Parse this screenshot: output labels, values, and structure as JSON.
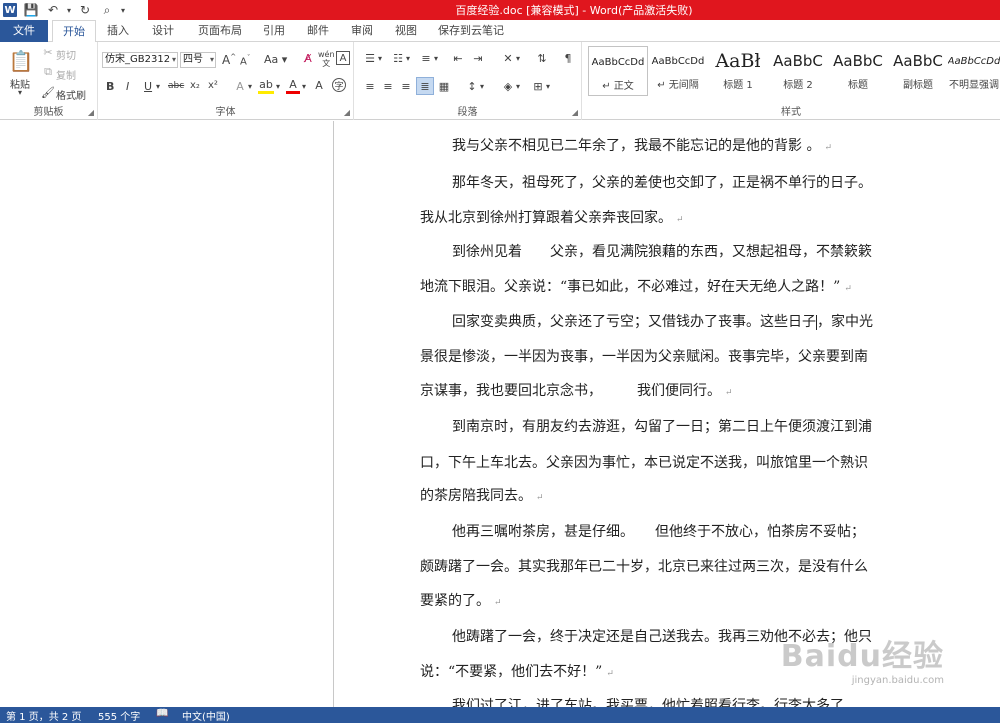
{
  "window": {
    "title": "百度经验.doc [兼容模式] - Word(产品激活失败)"
  },
  "tabs": [
    {
      "label": "文件"
    },
    {
      "label": "开始"
    },
    {
      "label": "插入"
    },
    {
      "label": "设计"
    },
    {
      "label": "页面布局"
    },
    {
      "label": "引用"
    },
    {
      "label": "邮件"
    },
    {
      "label": "审阅"
    },
    {
      "label": "视图"
    },
    {
      "label": "保存到云笔记"
    }
  ],
  "clipboard": {
    "paste": "粘贴",
    "cut": "剪切",
    "copy": "复制",
    "format_painter": "格式刷",
    "group_label": "剪贴板"
  },
  "font": {
    "name": "仿宋_GB2312",
    "size": "四号",
    "grow": "A",
    "shrink": "A",
    "case": "Aa",
    "bold": "B",
    "italic": "I",
    "underline": "U",
    "strike": "abc",
    "subscript": "x₂",
    "superscript": "x²",
    "phonetic": "wén",
    "group_label": "字体"
  },
  "paragraph": {
    "group_label": "段落"
  },
  "styles": {
    "group_label": "样式",
    "items": [
      {
        "preview": "AaBbCcDd",
        "name": "↵ 正文"
      },
      {
        "preview": "AaBbCcDd",
        "name": "↵ 无间隔"
      },
      {
        "preview": "AaBł",
        "name": "标题 1"
      },
      {
        "preview": "AaBbC",
        "name": "标题 2"
      },
      {
        "preview": "AaBbC",
        "name": "标题"
      },
      {
        "preview": "AaBbC",
        "name": "副标题"
      },
      {
        "preview": "AaBbCcDd",
        "name": "不明显强调"
      }
    ]
  },
  "document": {
    "lines": [
      "我与父亲不相见已二年余了，我最不能忘记的是他的背影 。",
      "那年冬天，祖母死了，父亲的差使也交卸了，正是祸不单行的日子。",
      "我从北京到徐州打算跟着父亲奔丧回家。",
      "到徐州见着　　父亲，看见满院狼藉的东西，又想起祖母，不禁簌簌",
      "地流下眼泪。父亲说：“事已如此，不必难过，好在天无绝人之路！”",
      "回家变卖典质，父亲还了亏空；又借钱办了丧事。这些日子",
      "，家中光",
      "景很是惨淡，一半因为丧事，一半因为父亲赋闲。丧事完毕，父亲要到南",
      "京谋事，我也要回北京念书，　　　我们便同行。",
      "到南京时，有朋友约去游逛，勾留了一日；第二日上午便须渡江到浦",
      "口，下午上车北去。父亲因为事忙，本已说定不送我，叫旅馆里一个熟识",
      "的茶房陪我同去。",
      "他再三嘱咐茶房，甚是仔细。　　但他终于不放心，怕茶房不妥帖；",
      "颇踌躇了一会。其实我那年已二十岁，北京已来往过两三次，是没有什么",
      "要紧的了。",
      "他踌躇了一会，终于决定还是自己送我去。我再三劝他不必去；他只",
      "说：“不要紧，他们去不好！”",
      "我们过了江，进了车站。我买票，他忙着照看行李。行李太多了"
    ],
    "para_mark": "↵"
  },
  "watermark": {
    "brand": "Baidu经验",
    "url": "jingyan.baidu.com"
  },
  "status": {
    "page": "第 1 页，共 2 页",
    "words": "555 个字",
    "lang": "中文(中国)"
  },
  "colors": {
    "accent": "#2b579a",
    "title_bar": "#e0161e"
  }
}
